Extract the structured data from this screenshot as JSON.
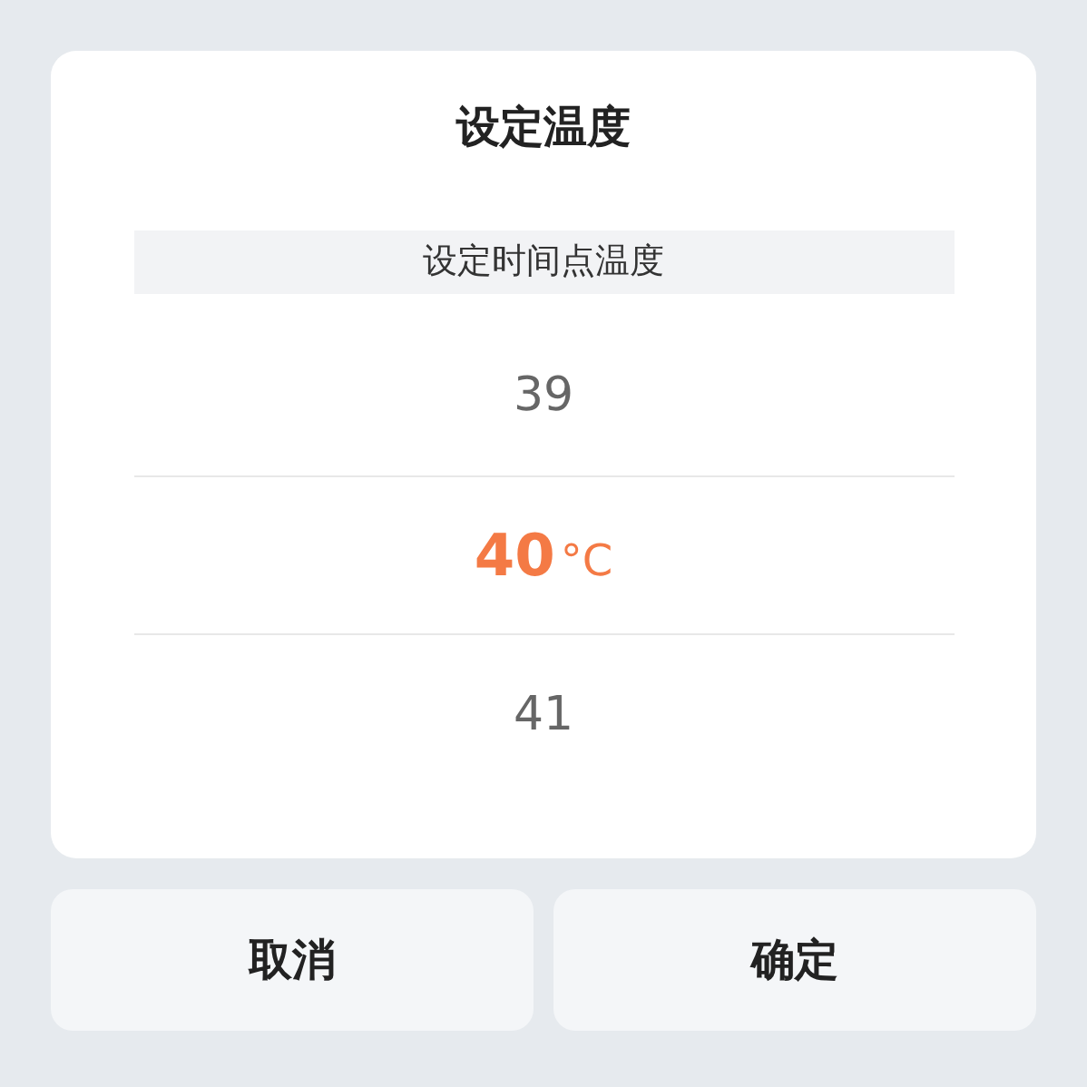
{
  "dialog": {
    "title": "设定温度",
    "subtitle": "设定时间点温度",
    "picker": {
      "unit": "°C",
      "items": [
        {
          "value": "39",
          "selected": false
        },
        {
          "value": "40",
          "selected": true
        },
        {
          "value": "41",
          "selected": false
        }
      ]
    }
  },
  "buttons": [
    {
      "label": "取消"
    },
    {
      "label": "确定"
    }
  ]
}
